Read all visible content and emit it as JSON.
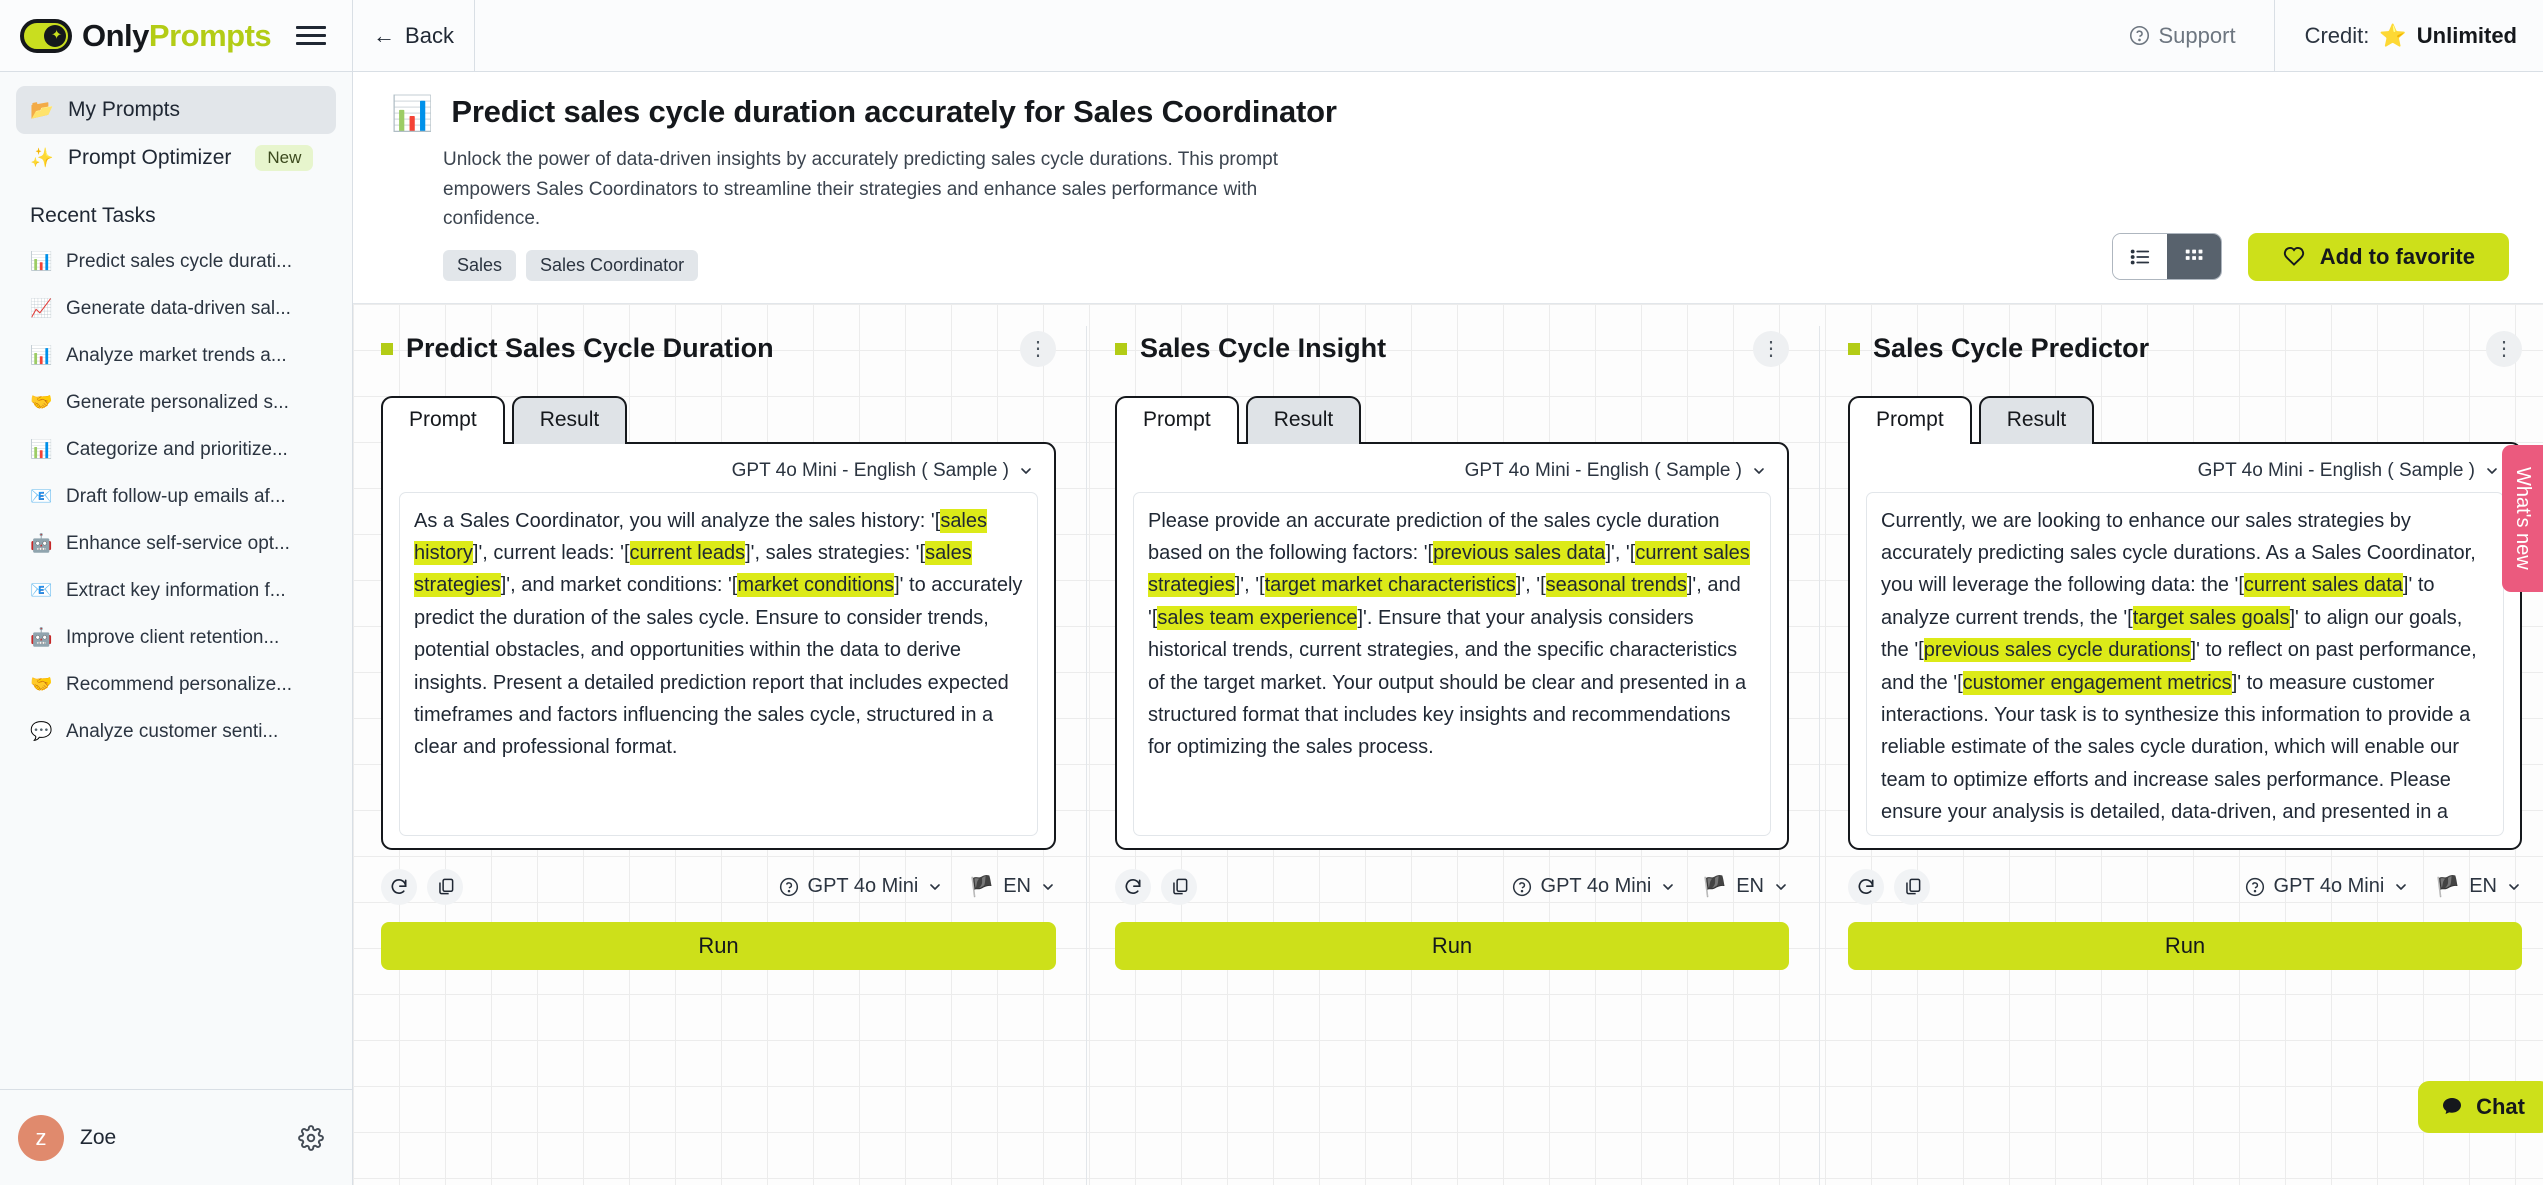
{
  "brand": {
    "name_part1": "Only",
    "name_part2": "Prompts"
  },
  "sidebar": {
    "nav": [
      {
        "icon": "📂",
        "label": "My Prompts",
        "badge": ""
      },
      {
        "icon": "✨",
        "label": "Prompt Optimizer",
        "badge": "New"
      }
    ],
    "section_title": "Recent Tasks",
    "tasks": [
      {
        "icon": "📊",
        "label": "Predict sales cycle durati..."
      },
      {
        "icon": "📈",
        "label": "Generate data-driven sal..."
      },
      {
        "icon": "📊",
        "label": "Analyze market trends a..."
      },
      {
        "icon": "🤝",
        "label": "Generate personalized s..."
      },
      {
        "icon": "📊",
        "label": "Categorize and prioritize..."
      },
      {
        "icon": "📧",
        "label": "Draft follow-up emails af..."
      },
      {
        "icon": "🤖",
        "label": "Enhance self-service opt..."
      },
      {
        "icon": "📧",
        "label": "Extract key information f..."
      },
      {
        "icon": "🤖",
        "label": "Improve client retention..."
      },
      {
        "icon": "🤝",
        "label": "Recommend personalize..."
      },
      {
        "icon": "💬",
        "label": "Analyze customer senti..."
      }
    ],
    "user": {
      "initial": "z",
      "name": "Zoe"
    }
  },
  "topbar": {
    "back_label": "Back",
    "support_label": "Support",
    "credit_label": "Credit:",
    "credit_value": "Unlimited",
    "credit_icon": "⭐"
  },
  "header": {
    "emoji": "📊",
    "title": "Predict sales cycle duration accurately for Sales Coordinator",
    "description": "Unlock the power of data-driven insights by accurately predicting sales cycle durations. This prompt empowers Sales Coordinators to streamline their strategies and enhance sales performance with confidence.",
    "tags": [
      "Sales",
      "Sales Coordinator"
    ],
    "favorite_label": "Add to favorite"
  },
  "cards": [
    {
      "title": "Predict Sales Cycle Duration",
      "tab_prompt": "Prompt",
      "tab_result": "Result",
      "model_sample": "GPT 4o Mini - English ( Sample )",
      "model_footer": "GPT 4o Mini",
      "language": "EN",
      "run_label": "Run",
      "prompt_segments": [
        {
          "t": "As a Sales Coordinator, you will analyze the sales history: '[",
          "h": false
        },
        {
          "t": "sales history",
          "h": true
        },
        {
          "t": "]', current leads: '[",
          "h": false
        },
        {
          "t": "current leads",
          "h": true
        },
        {
          "t": "]', sales strategies: '[",
          "h": false
        },
        {
          "t": "sales strategies",
          "h": true
        },
        {
          "t": "]', and market conditions: '[",
          "h": false
        },
        {
          "t": "market conditions",
          "h": true
        },
        {
          "t": "]' to accurately predict the duration of the sales cycle. Ensure to consider trends, potential obstacles, and opportunities within the data to derive insights. Present a detailed prediction report that includes expected timeframes and factors influencing the sales cycle, structured in a clear and professional format.",
          "h": false
        }
      ]
    },
    {
      "title": "Sales Cycle Insight",
      "tab_prompt": "Prompt",
      "tab_result": "Result",
      "model_sample": "GPT 4o Mini - English ( Sample )",
      "model_footer": "GPT 4o Mini",
      "language": "EN",
      "run_label": "Run",
      "prompt_segments": [
        {
          "t": "Please provide an accurate prediction of the sales cycle duration based on the following factors: '[",
          "h": false
        },
        {
          "t": "previous sales data",
          "h": true
        },
        {
          "t": "]', '[",
          "h": false
        },
        {
          "t": "current sales strategies",
          "h": true
        },
        {
          "t": "]', '[",
          "h": false
        },
        {
          "t": "target market characteristics",
          "h": true
        },
        {
          "t": "]', '[",
          "h": false
        },
        {
          "t": "seasonal trends",
          "h": true
        },
        {
          "t": "]', and '[",
          "h": false
        },
        {
          "t": "sales team experience",
          "h": true
        },
        {
          "t": "]'. Ensure that your analysis considers historical trends, current strategies, and the specific characteristics of the target market. Your output should be clear and presented in a structured format that includes key insights and recommendations for optimizing the sales process.",
          "h": false
        }
      ]
    },
    {
      "title": "Sales Cycle Predictor",
      "tab_prompt": "Prompt",
      "tab_result": "Result",
      "model_sample": "GPT 4o Mini - English ( Sample )",
      "model_footer": "GPT 4o Mini",
      "language": "EN",
      "run_label": "Run",
      "prompt_segments": [
        {
          "t": "Currently, we are looking to enhance our sales strategies by accurately predicting sales cycle durations. As a Sales Coordinator, you will leverage the following data: the '[",
          "h": false
        },
        {
          "t": "current sales data",
          "h": true
        },
        {
          "t": "]' to analyze current trends, the '[",
          "h": false
        },
        {
          "t": "target sales goals",
          "h": true
        },
        {
          "t": "]' to align our goals, the '[",
          "h": false
        },
        {
          "t": "previous sales cycle durations",
          "h": true
        },
        {
          "t": "]' to reflect on past performance, and the '[",
          "h": false
        },
        {
          "t": "customer engagement metrics",
          "h": true
        },
        {
          "t": "]' to measure customer interactions. Your task is to synthesize this information to provide a reliable estimate of the sales cycle duration, which will enable our team to optimize efforts and increase sales performance. Please ensure your analysis is detailed, data-driven, and presented in a structured format that highlights key insights and recommendations.",
          "h": false
        }
      ]
    }
  ],
  "floating": {
    "whats_new": "What's new",
    "chat": "Chat"
  }
}
